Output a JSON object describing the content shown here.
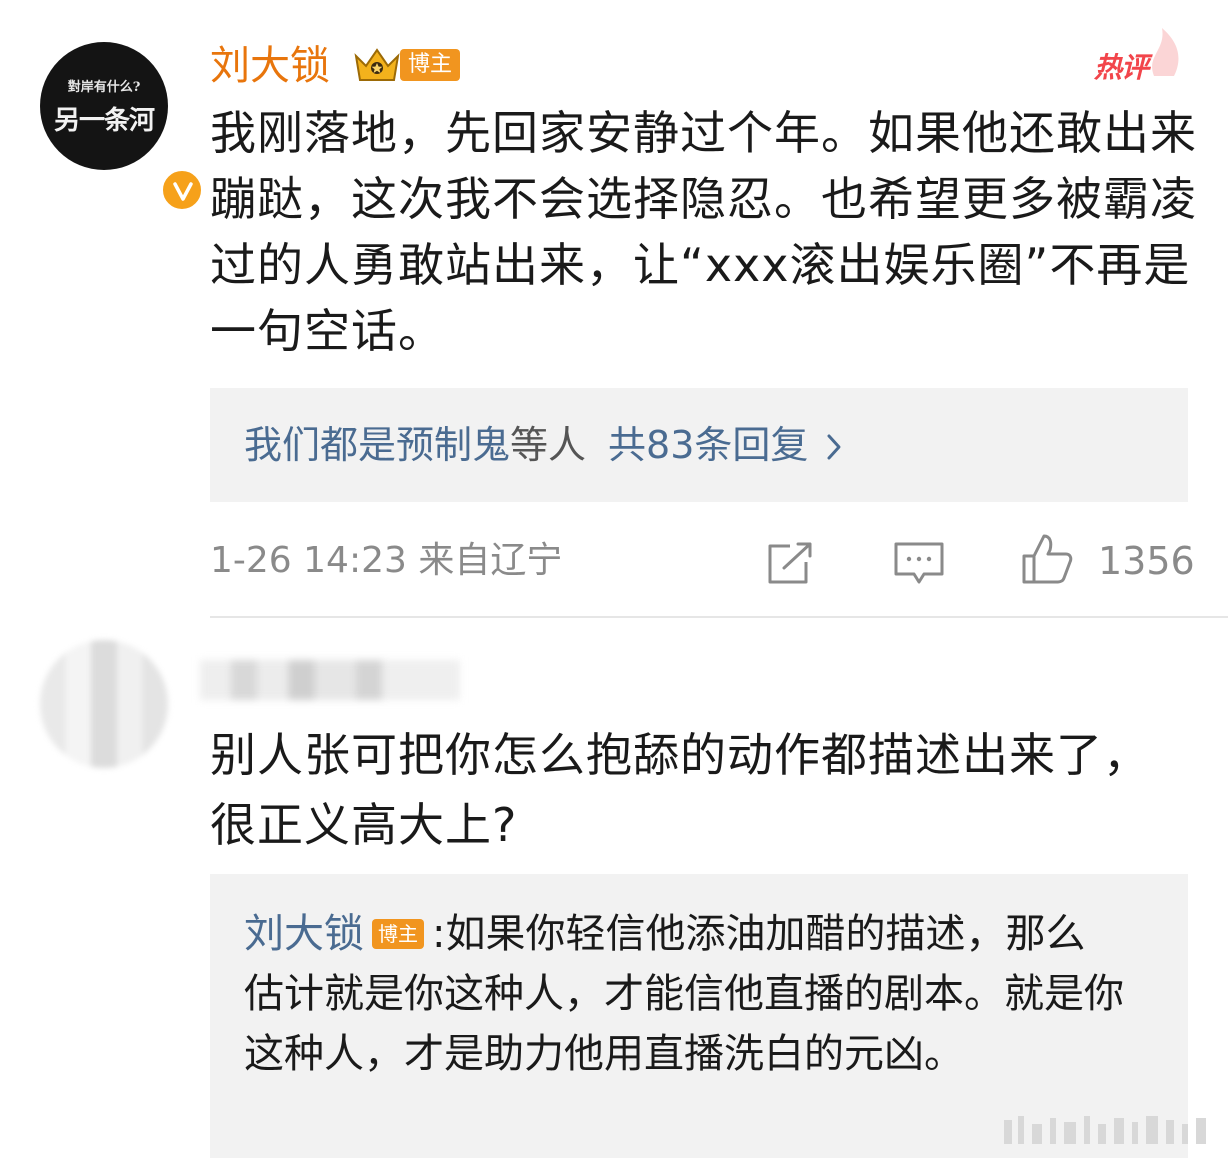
{
  "comment": {
    "avatar": {
      "top_text": "對岸有什么?",
      "main_text": "另一条河"
    },
    "username": "刘大锁",
    "blogger_tag": "博主",
    "hot_label": "热评",
    "text": "我刚落地，先回家安静过个年。如果他还敢出来蹦跶，这次我不会选择隐忍。也希望更多被霸凌过的人勇敢站出来，让“xxx滚出娱乐圈”不再是一句空话。",
    "replies": {
      "names": "我们都是预制鬼",
      "suffix": "等人",
      "count_text": "共83条回复"
    },
    "meta": "1-26 14:23 来自辽宁",
    "like_count": "1356"
  },
  "second_comment": {
    "text": "别人张可把你怎么抱舔的动作都描述出来了，很正义高大上?",
    "reply": {
      "name": "刘大锁",
      "blogger_tag": "博主",
      "separator": ":",
      "text": "如果你轻信他添油加醋的描述，那么估计就是你这种人，才能信他直播的剧本。就是你这种人，才是助力他用直播洗白的元凶。"
    }
  },
  "colors": {
    "username": "#e8750c",
    "link_blue": "#4a6b91",
    "tag_orange": "#f1951f",
    "hot_red": "#f2454b",
    "meta_gray": "#8a8a8a"
  },
  "icons": [
    "verified-icon",
    "crown-icon",
    "hot-flame-icon",
    "chevron-right-icon",
    "share-icon",
    "comment-icon",
    "like-icon"
  ]
}
